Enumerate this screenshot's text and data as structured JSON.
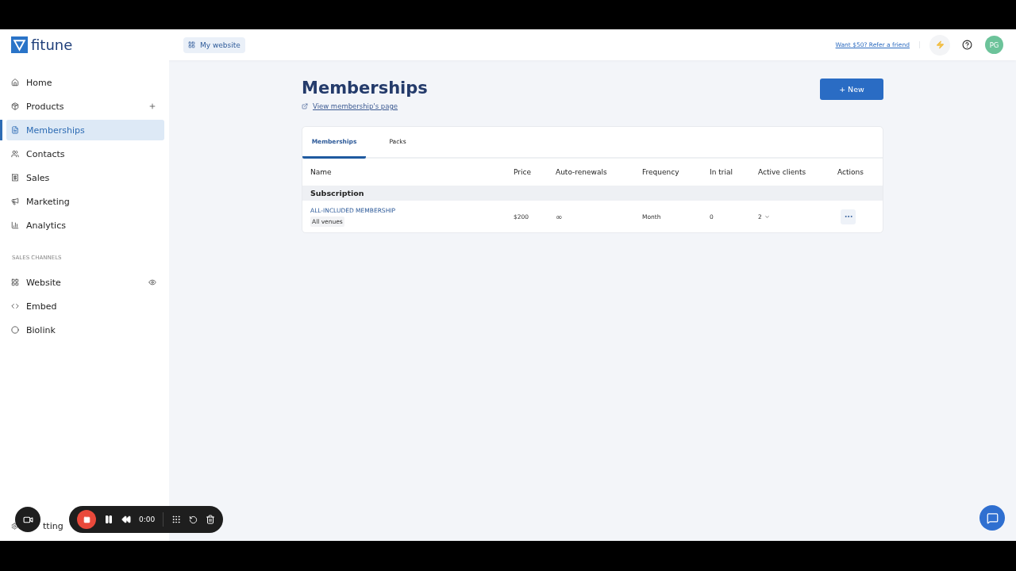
{
  "header": {
    "logo": "fitune",
    "website_button": "My website",
    "refer_link": "Want $50? Refer a friend",
    "avatar": "PG"
  },
  "sidebar": {
    "items": [
      {
        "label": "Home",
        "selected": false,
        "kind": "plain"
      },
      {
        "label": "Products",
        "selected": false,
        "kind": "add"
      },
      {
        "label": "Memberships",
        "selected": true,
        "kind": "plain"
      },
      {
        "label": "Contacts",
        "selected": false,
        "kind": "plain"
      },
      {
        "label": "Sales",
        "selected": false,
        "kind": "plain"
      },
      {
        "label": "Marketing",
        "selected": false,
        "kind": "plain"
      },
      {
        "label": "Analytics",
        "selected": false,
        "kind": "plain"
      }
    ],
    "section_title": "SALES CHANNELS",
    "channels": [
      {
        "label": "Website",
        "selected": false,
        "kind": "preview"
      },
      {
        "label": "Embed",
        "selected": false,
        "kind": "plain"
      },
      {
        "label": "Biolink",
        "selected": false,
        "kind": "plain"
      }
    ],
    "footer_item": "tting"
  },
  "page": {
    "title": "Memberships",
    "view_link": "View membership's page",
    "new_button": "+ New"
  },
  "tabs": [
    {
      "label": "Memberships",
      "selected": true
    },
    {
      "label": "Packs",
      "selected": false
    }
  ],
  "table": {
    "columns": [
      "Name",
      "Price",
      "Auto-renewals",
      "Frequency",
      "In trial",
      "Active clients",
      "Actions"
    ],
    "groups": [
      {
        "title": "Subscription",
        "rows": [
          {
            "name": "ALL-INCLUDED MEMBERSHIP",
            "tag": "All venues",
            "price": "$200",
            "auto_renewals": "∞",
            "frequency": "Month",
            "in_trial": "0",
            "active_clients": "2"
          }
        ]
      }
    ]
  },
  "recorder": {
    "time": "0:00"
  }
}
